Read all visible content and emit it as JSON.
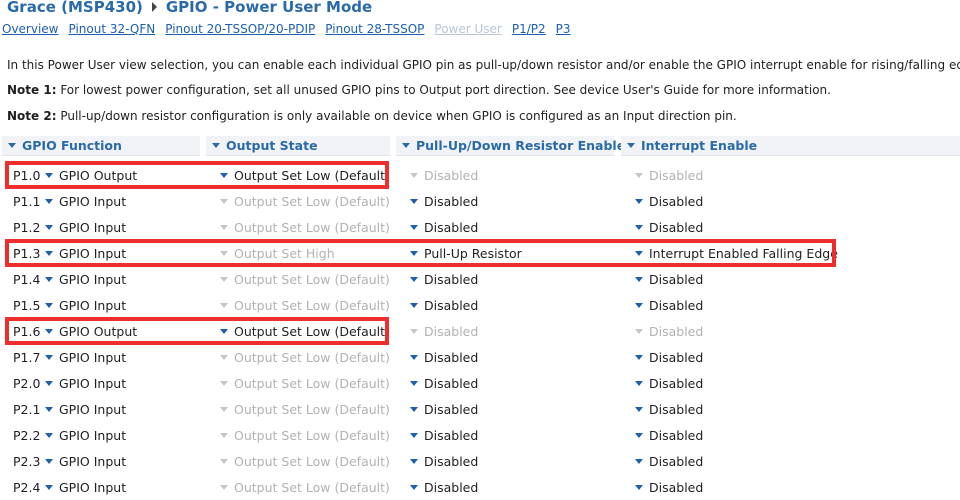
{
  "breadcrumb": {
    "device": "Grace (MSP430)",
    "page": "GPIO - Power User Mode"
  },
  "nav_links": [
    {
      "label": "Overview",
      "disabled": false
    },
    {
      "label": "Pinout 32-QFN",
      "disabled": false
    },
    {
      "label": "Pinout 20-TSSOP/20-PDIP",
      "disabled": false
    },
    {
      "label": "Pinout 28-TSSOP",
      "disabled": false
    },
    {
      "label": "Power User",
      "disabled": true
    },
    {
      "label": "P1/P2",
      "disabled": false
    },
    {
      "label": "P3",
      "disabled": false
    }
  ],
  "intro": {
    "text": "In this Power User view selection, you can enable each individual GPIO pin as pull-up/down resistor and/or enable the GPIO interrupt enable for rising/falling edge.",
    "note1_label": "Note 1:",
    "note1_text": " For lowest power configuration, set all unused GPIO pins to Output port direction. See device User's Guide for more information.",
    "note2_label": "Note 2:",
    "note2_text": " Pull-up/down resistor configuration is only available on device when GPIO is configured as an Input direction pin."
  },
  "columns": [
    "GPIO Function",
    "Output State",
    "Pull-Up/Down Resistor Enable",
    "Interrupt Enable"
  ],
  "rows": [
    {
      "pin": "P1.0",
      "function": "GPIO Output",
      "output": "Output Set Low (Default)",
      "output_enabled": true,
      "resistor": "Disabled",
      "resistor_enabled": false,
      "interrupt": "Disabled",
      "interrupt_enabled": false,
      "highlight": "left"
    },
    {
      "pin": "P1.1",
      "function": "GPIO Input",
      "output": "Output Set Low (Default)",
      "output_enabled": false,
      "resistor": "Disabled",
      "resistor_enabled": true,
      "interrupt": "Disabled",
      "interrupt_enabled": true,
      "highlight": ""
    },
    {
      "pin": "P1.2",
      "function": "GPIO Input",
      "output": "Output Set Low (Default)",
      "output_enabled": false,
      "resistor": "Disabled",
      "resistor_enabled": true,
      "interrupt": "Disabled",
      "interrupt_enabled": true,
      "highlight": ""
    },
    {
      "pin": "P1.3",
      "function": "GPIO Input",
      "output": "Output Set High",
      "output_enabled": false,
      "resistor": "Pull-Up Resistor",
      "resistor_enabled": true,
      "interrupt": "Interrupt Enabled Falling Edge",
      "interrupt_enabled": true,
      "highlight": "full"
    },
    {
      "pin": "P1.4",
      "function": "GPIO Input",
      "output": "Output Set Low (Default)",
      "output_enabled": false,
      "resistor": "Disabled",
      "resistor_enabled": true,
      "interrupt": "Disabled",
      "interrupt_enabled": true,
      "highlight": ""
    },
    {
      "pin": "P1.5",
      "function": "GPIO Input",
      "output": "Output Set Low (Default)",
      "output_enabled": false,
      "resistor": "Disabled",
      "resistor_enabled": true,
      "interrupt": "Disabled",
      "interrupt_enabled": true,
      "highlight": ""
    },
    {
      "pin": "P1.6",
      "function": "GPIO Output",
      "output": "Output Set Low (Default)",
      "output_enabled": true,
      "resistor": "Disabled",
      "resistor_enabled": false,
      "interrupt": "Disabled",
      "interrupt_enabled": false,
      "highlight": "left"
    },
    {
      "pin": "P1.7",
      "function": "GPIO Input",
      "output": "Output Set Low (Default)",
      "output_enabled": false,
      "resistor": "Disabled",
      "resistor_enabled": true,
      "interrupt": "Disabled",
      "interrupt_enabled": true,
      "highlight": ""
    },
    {
      "pin": "P2.0",
      "function": "GPIO Input",
      "output": "Output Set Low (Default)",
      "output_enabled": false,
      "resistor": "Disabled",
      "resistor_enabled": true,
      "interrupt": "Disabled",
      "interrupt_enabled": true,
      "highlight": ""
    },
    {
      "pin": "P2.1",
      "function": "GPIO Input",
      "output": "Output Set Low (Default)",
      "output_enabled": false,
      "resistor": "Disabled",
      "resistor_enabled": true,
      "interrupt": "Disabled",
      "interrupt_enabled": true,
      "highlight": ""
    },
    {
      "pin": "P2.2",
      "function": "GPIO Input",
      "output": "Output Set Low (Default)",
      "output_enabled": false,
      "resistor": "Disabled",
      "resistor_enabled": true,
      "interrupt": "Disabled",
      "interrupt_enabled": true,
      "highlight": ""
    },
    {
      "pin": "P2.3",
      "function": "GPIO Input",
      "output": "Output Set Low (Default)",
      "output_enabled": false,
      "resistor": "Disabled",
      "resistor_enabled": true,
      "interrupt": "Disabled",
      "interrupt_enabled": true,
      "highlight": ""
    },
    {
      "pin": "P2.4",
      "function": "GPIO Input",
      "output": "Output Set Low (Default)",
      "output_enabled": false,
      "resistor": "Disabled",
      "resistor_enabled": true,
      "interrupt": "Disabled",
      "interrupt_enabled": true,
      "highlight": ""
    }
  ],
  "colors": {
    "link": "#1b5fb4",
    "header_text": "#2a6aa8",
    "disabled_text": "#b2b2b2",
    "highlight_border": "#ee2d2d"
  }
}
